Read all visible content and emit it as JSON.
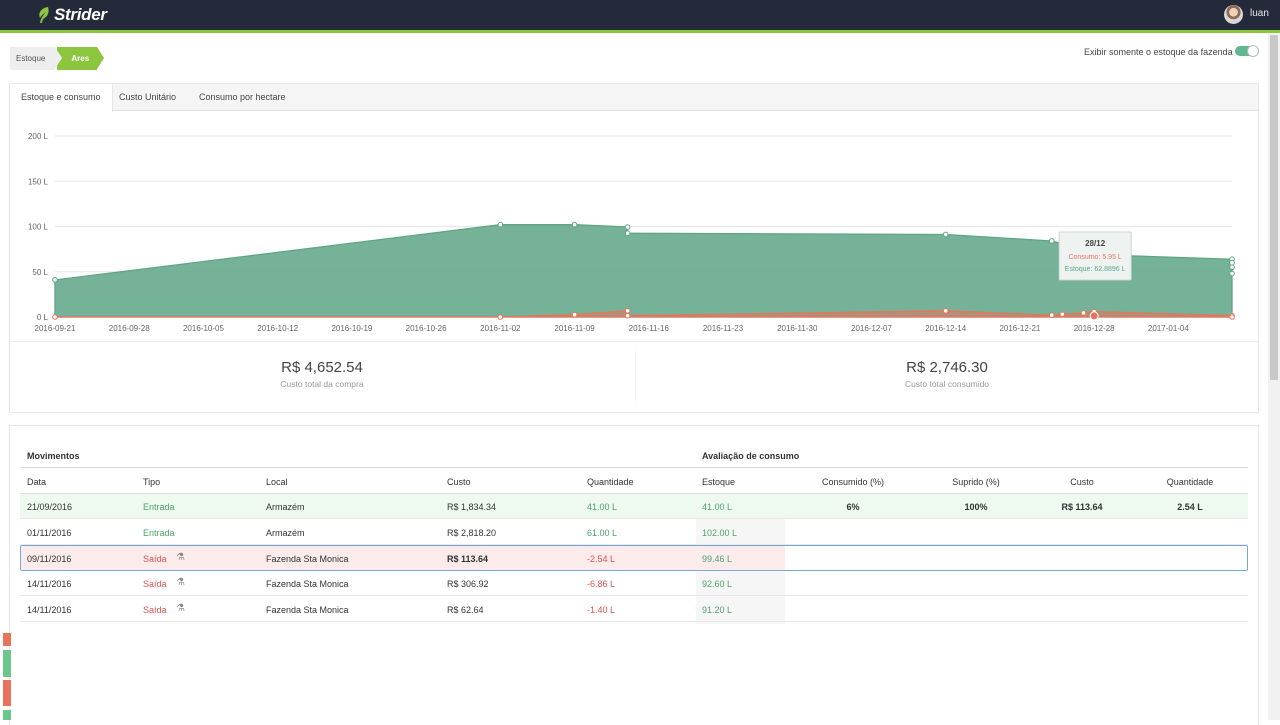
{
  "app": {
    "logo": "Strider",
    "username": "luan"
  },
  "breadcrumb": [
    "Estoque",
    "Ares"
  ],
  "toggle": {
    "label": "Exibir somente o estoque da fazenda",
    "on": true,
    "color": "#5fb88f"
  },
  "tabs": [
    "Estoque e consumo",
    "Custo Unitário",
    "Consumo por hectare"
  ],
  "chart_data": {
    "type": "area",
    "y_ticks": [
      "200 L",
      "150 L",
      "100 L",
      "50 L",
      "0 L"
    ],
    "ylim": [
      0,
      200
    ],
    "x_ticks": [
      "2016-09-21",
      "2016-09-28",
      "2016-10-05",
      "2016-10-12",
      "2016-10-19",
      "2016-10-26",
      "2016-11-02",
      "2016-11-09",
      "2016-11-16",
      "2016-11-23",
      "2016-11-30",
      "2016-12-07",
      "2016-12-14",
      "2016-12-21",
      "2016-12-28",
      "2017-01-04"
    ],
    "x_start": "2016-09-21",
    "x_end": "2017-01-10",
    "series": [
      {
        "color": "#5ea585",
        "points": [
          [
            "2016-09-21",
            41
          ],
          [
            "2016-11-02",
            102
          ],
          [
            "2016-11-09",
            102
          ],
          [
            "2016-11-14",
            99.46
          ],
          [
            "2016-11-14",
            92.6
          ],
          [
            "2016-12-14",
            91.2
          ],
          [
            "2016-12-24",
            84
          ],
          [
            "2016-12-25",
            81
          ],
          [
            "2016-12-27",
            76
          ],
          [
            "2016-12-28",
            68.79
          ],
          [
            "2017-01-10",
            63.9
          ],
          [
            "2017-01-10",
            60
          ],
          [
            "2017-01-10",
            55
          ],
          [
            "2017-01-10",
            48
          ]
        ]
      },
      {
        "color": "#e8735a",
        "points": [
          [
            "2016-09-21",
            0
          ],
          [
            "2016-11-02",
            0
          ],
          [
            "2016-11-09",
            2.54
          ],
          [
            "2016-11-14",
            6.86
          ],
          [
            "2016-11-14",
            1.4
          ],
          [
            "2016-12-14",
            6.8
          ],
          [
            "2016-12-24",
            2
          ],
          [
            "2016-12-25",
            3
          ],
          [
            "2016-12-27",
            4.5
          ],
          [
            "2016-12-28",
            5.95
          ],
          [
            "2017-01-10",
            1.5
          ],
          [
            "2017-01-10",
            0
          ]
        ]
      }
    ],
    "tooltip": {
      "title": "28/12",
      "consumo": "Consumo: 5.95 L",
      "estoque": "Estoque: 62.8896 L"
    }
  },
  "stats": [
    {
      "value": "R$ 4,652.54",
      "label": "Custo total da compra"
    },
    {
      "value": "R$ 2,746.30",
      "label": "Custo total consumido"
    }
  ],
  "movimentos": {
    "title": "Movimentos",
    "headers": {
      "data": "Data",
      "tipo": "Tipo",
      "local": "Local",
      "custo": "Custo",
      "quantidade": "Quantidade",
      "estoque": "Estoque"
    },
    "rows": [
      {
        "data": "21/09/2016",
        "tipo": "Entrada",
        "local": "Armazém",
        "custo": "R$ 1,834.34",
        "quantidade": "41.00 L",
        "estoque": "41.00 L"
      },
      {
        "data": "01/11/2016",
        "tipo": "Entrada",
        "local": "Armazém",
        "custo": "R$ 2,818.20",
        "quantidade": "61.00 L",
        "estoque": "102.00 L"
      },
      {
        "data": "09/11/2016",
        "tipo": "Saída",
        "local": "Fazenda Sta Monica",
        "custo": "R$ 113.64",
        "quantidade": "-2.54 L",
        "estoque": "99.46 L"
      },
      {
        "data": "14/11/2016",
        "tipo": "Saída",
        "local": "Fazenda Sta Monica",
        "custo": "R$ 306.92",
        "quantidade": "-6.86 L",
        "estoque": "92.60 L"
      },
      {
        "data": "14/11/2016",
        "tipo": "Saída",
        "local": "Fazenda Sta Monica",
        "custo": "R$ 62.64",
        "quantidade": "-1.40 L",
        "estoque": "91.20 L"
      }
    ]
  },
  "avaliacao": {
    "title": "Avaliação de consumo",
    "headers": {
      "consumido": "Consumido (%)",
      "suprido": "Suprido (%)",
      "custo": "Custo",
      "quantidade": "Quantidade"
    },
    "row": {
      "consumido": "6%",
      "suprido": "100%",
      "custo": "R$ 113.64",
      "quantidade": "2.54 L"
    }
  },
  "colors": {
    "green": "#4aa36a",
    "red": "#d9534f",
    "accent": "#8cc63f",
    "topbar": "#252a3a"
  }
}
